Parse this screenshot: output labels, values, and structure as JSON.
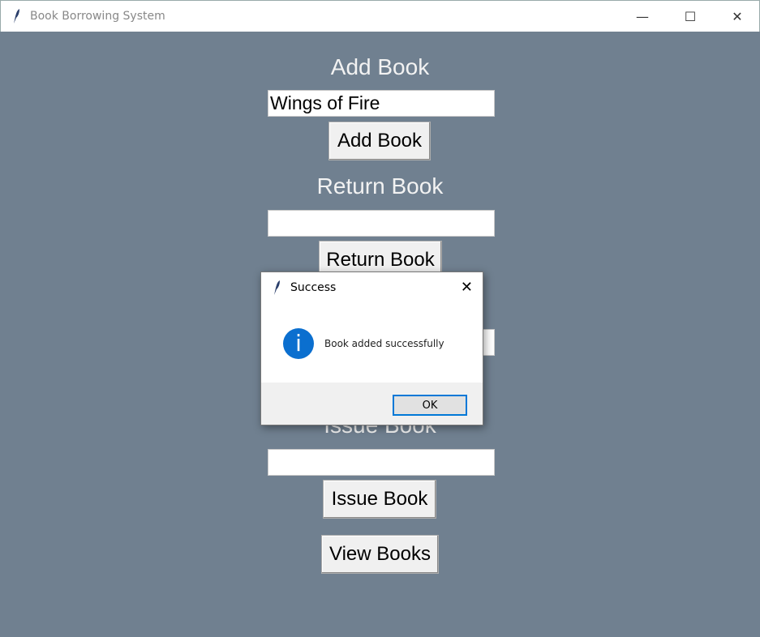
{
  "window": {
    "title": "Book Borrowing System",
    "icon": "feather-icon"
  },
  "add": {
    "label": "Add Book",
    "value": "Wings of Fire",
    "button": "Add Book"
  },
  "return": {
    "label": "Return Book",
    "value": "",
    "button": "Return Book"
  },
  "hidden": {
    "value": ""
  },
  "issue": {
    "label": "Issue Book",
    "value": "",
    "button": "Issue Book"
  },
  "view": {
    "button": "View Books"
  },
  "dialog": {
    "title": "Success",
    "message": "Book added successfully",
    "ok": "OK",
    "icon": "info-icon"
  },
  "colors": {
    "background": "#708090",
    "accent": "#0078d7"
  }
}
